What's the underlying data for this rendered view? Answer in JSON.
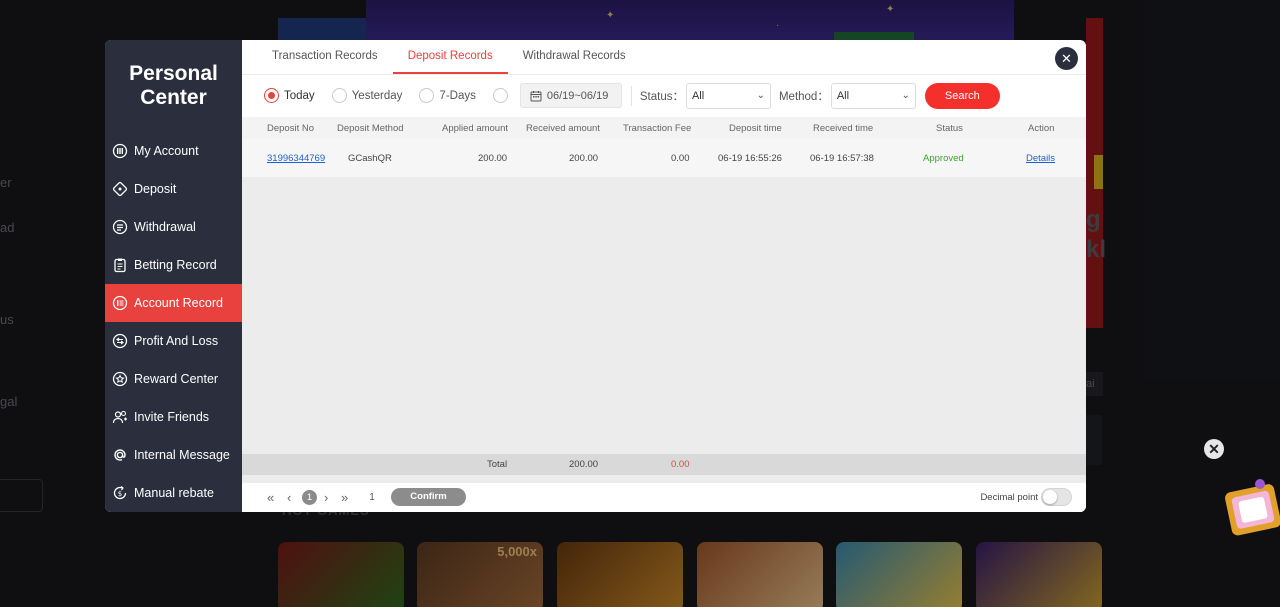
{
  "background": {
    "side_labels": [
      "er",
      "ad",
      "us",
      "gal"
    ],
    "right_labels": [
      "g",
      "kl",
      "ai"
    ],
    "games_title": "HOT GAMES",
    "game_tag": "5,000x",
    "float_close": "✕"
  },
  "sidebar": {
    "title_line1": "Personal",
    "title_line2": "Center",
    "items": [
      {
        "label": "My Account",
        "icon": "my-account-icon"
      },
      {
        "label": "Deposit",
        "icon": "deposit-icon"
      },
      {
        "label": "Withdrawal",
        "icon": "withdrawal-icon"
      },
      {
        "label": "Betting Record",
        "icon": "clipboard-icon"
      },
      {
        "label": "Account Record",
        "icon": "ledger-icon",
        "active": true
      },
      {
        "label": "Profit And Loss",
        "icon": "profit-loss-icon"
      },
      {
        "label": "Reward Center",
        "icon": "reward-icon"
      },
      {
        "label": "Invite Friends",
        "icon": "invite-friends-icon"
      },
      {
        "label": "Internal Message",
        "icon": "at-sign-icon"
      },
      {
        "label": "Manual rebate",
        "icon": "rebate-icon"
      }
    ]
  },
  "tabs": [
    "Transaction Records",
    "Deposit Records",
    "Withdrawal Records"
  ],
  "active_tab": "Deposit Records",
  "filters": {
    "today": "Today",
    "yesterday": "Yesterday",
    "seven_days": "7-Days",
    "date_range": "06/19~06/19",
    "status_label": "Status：",
    "status_value": "All",
    "method_label": "Method：",
    "method_value": "All",
    "search": "Search"
  },
  "table": {
    "headers": [
      "Deposit No",
      "Deposit Method",
      "Applied amount",
      "Received amount",
      "Transaction Fee",
      "Deposit time",
      "Received time",
      "Status",
      "Action"
    ],
    "rows": [
      {
        "deposit_no": "31996344769",
        "method": "GCashQR",
        "applied": "200.00",
        "received": "200.00",
        "fee": "0.00",
        "deposit_time": "06-19 16:55:26",
        "received_time": "06-19 16:57:38",
        "status": "Approved",
        "action": "Details"
      }
    ],
    "footer": {
      "label": "Total",
      "received_total": "200.00",
      "fee_total": "0.00"
    }
  },
  "pagination": {
    "current": "1",
    "page_input": "1",
    "confirm": "Confirm",
    "decimal_label": "Decimal point"
  },
  "colors": {
    "accent": "#e8413e",
    "sidebar_bg": "#2b2f3d",
    "approved": "#39a52c",
    "link": "#1f5fd6"
  }
}
